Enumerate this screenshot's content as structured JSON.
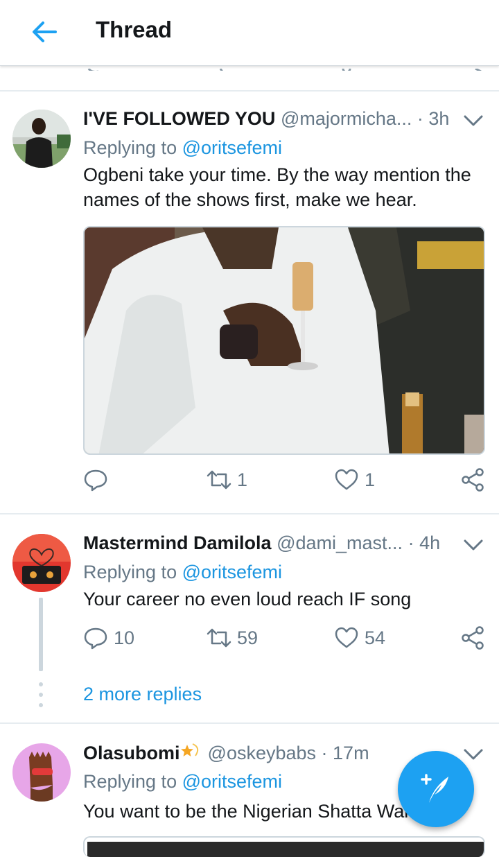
{
  "header": {
    "title": "Thread",
    "back_icon": "arrow-left-icon"
  },
  "tweets": [
    {
      "name": "I'VE FOLLOWED YOU",
      "handle": "@majormicha...",
      "time": "· 3h",
      "replying_prefix": "Replying to ",
      "replying_to": "@oritsefemi",
      "text_line1": "Ogbeni  take your time. By the way mention the",
      "text_line2": "names of the shows first, make we hear.",
      "replies": "",
      "retweets": "1",
      "likes": "1"
    },
    {
      "name": "Mastermind Damilola",
      "handle": "@dami_mast...",
      "time": "· 4h",
      "replying_prefix": "Replying to ",
      "replying_to": "@oritsefemi",
      "text_line1": "Your career no even loud reach IF song",
      "replies": "10",
      "retweets": "59",
      "likes": "54",
      "more_replies": "2 more replies"
    },
    {
      "name": "Olasubomi",
      "handle": "@oskeybabs",
      "time": "· 17m",
      "replying_prefix": "Replying to ",
      "replying_to": "@oritsefemi",
      "text_line1": "You want to be the Nigerian Shatta Wale?"
    }
  ],
  "colors": {
    "accent": "#1da1f2",
    "link": "#1b95e0",
    "muted": "#657786",
    "text": "#14171a"
  },
  "icons": [
    "reply-icon",
    "retweet-icon",
    "like-icon",
    "share-icon",
    "chevron-down-icon",
    "compose-icon",
    "star-icon"
  ]
}
